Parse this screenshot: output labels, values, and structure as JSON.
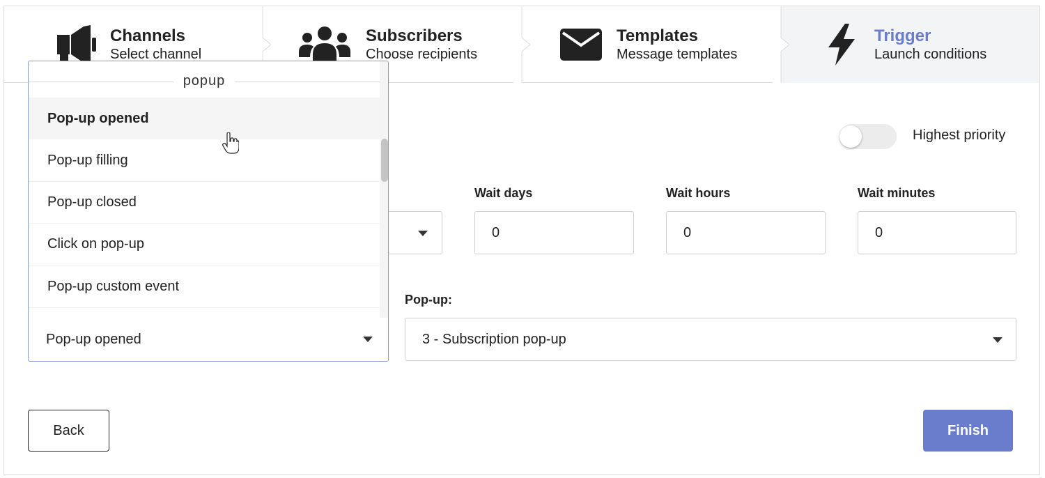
{
  "stepper": {
    "steps": [
      {
        "title": "Channels",
        "subtitle": "Select channel",
        "icon": "megaphone-icon"
      },
      {
        "title": "Subscribers",
        "subtitle": "Choose recipients",
        "icon": "users-icon"
      },
      {
        "title": "Templates",
        "subtitle": "Message templates",
        "icon": "envelope-icon"
      },
      {
        "title": "Trigger",
        "subtitle": "Launch conditions",
        "icon": "lightning-icon",
        "active": true
      }
    ]
  },
  "priority": {
    "label": "Highest priority",
    "enabled": false
  },
  "wait": {
    "days_label": "Wait days",
    "days_value": "0",
    "hours_label": "Wait hours",
    "hours_value": "0",
    "minutes_label": "Wait minutes",
    "minutes_value": "0"
  },
  "event_dropdown": {
    "group_label": "popup",
    "options": [
      "Pop-up opened",
      "Pop-up filling",
      "Pop-up closed",
      "Click on pop-up",
      "Pop-up custom event"
    ],
    "hovered_option": "Pop-up opened",
    "selected_value": "Pop-up opened"
  },
  "popup_select": {
    "label": "Pop-up:",
    "value": "3 - Subscription pop-up"
  },
  "actions": {
    "back_label": "Back",
    "finish_label": "Finish"
  },
  "colors": {
    "accent": "#6a7ccc",
    "active_step_bg": "#f3f4f6",
    "dropdown_border": "#8a98d4"
  }
}
